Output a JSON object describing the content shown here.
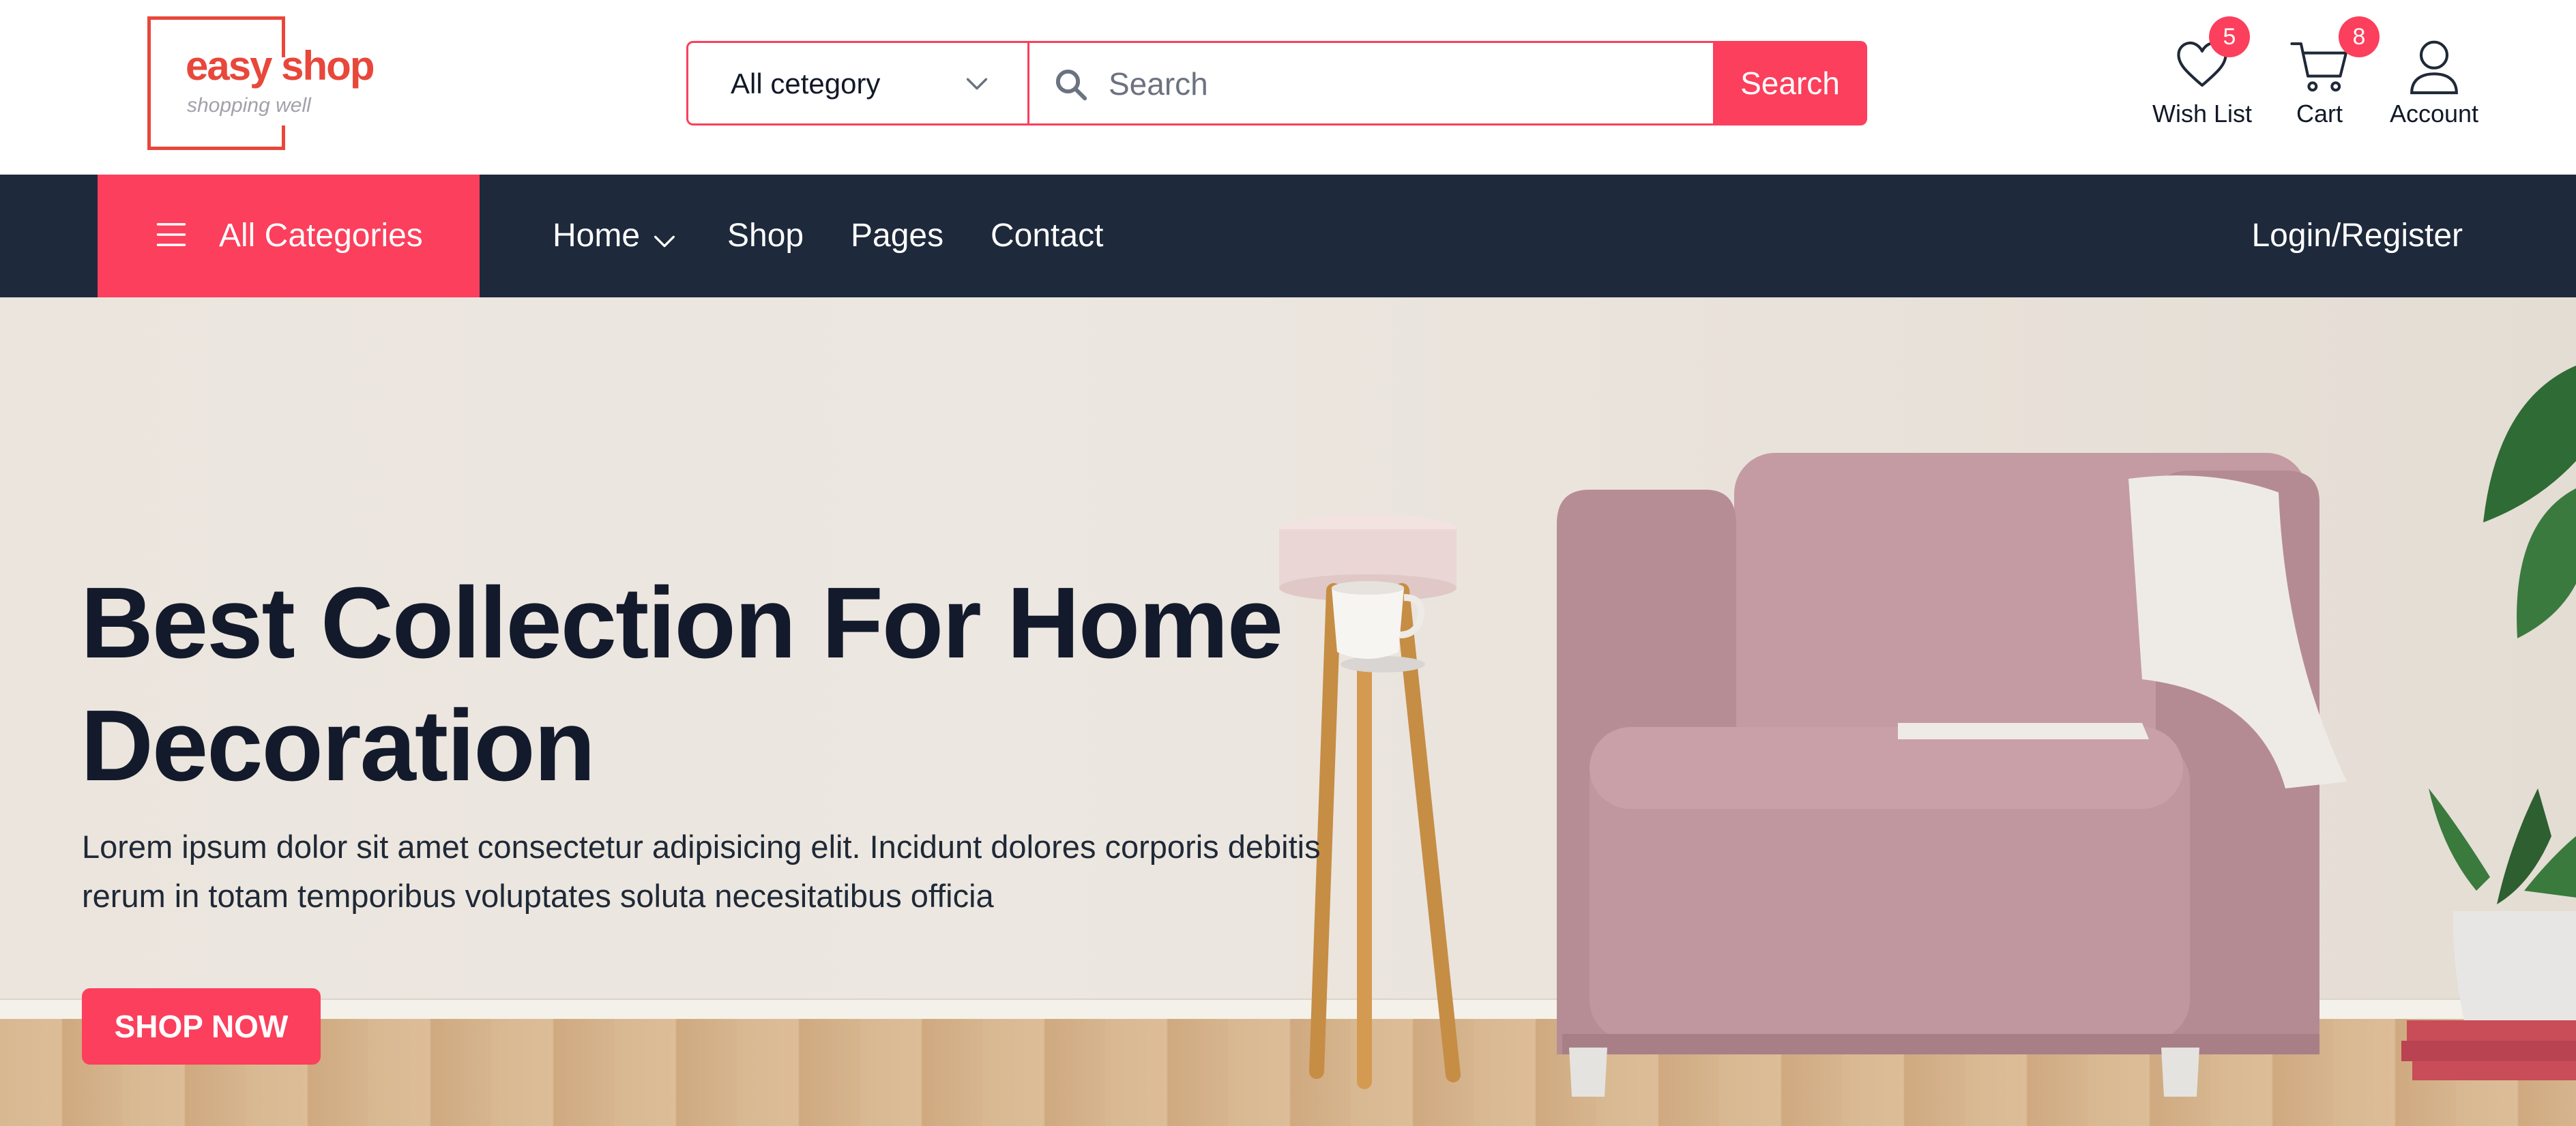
{
  "logo": {
    "title": "easy shop",
    "tagline": "shopping well"
  },
  "search": {
    "category_selected": "All cetegory",
    "placeholder": "Search",
    "button_label": "Search"
  },
  "header_actions": {
    "wishlist": {
      "label": "Wish List",
      "count": "5",
      "icon": "heart-icon"
    },
    "cart": {
      "label": "Cart",
      "count": "8",
      "icon": "cart-icon"
    },
    "account": {
      "label": "Account",
      "icon": "user-icon"
    }
  },
  "nav": {
    "all_categories": "All Categories",
    "links": [
      "Home",
      "Shop",
      "Pages",
      "Contact"
    ],
    "login": "Login/Register"
  },
  "hero": {
    "title": "Best Collection For Home Decoration",
    "description": "Lorem ipsum dolor sit amet consectetur adipisicing elit. Incidunt dolores corporis debitis rerum in totam temporibus voluptates soluta necesitatibus officia",
    "cta": "SHOP NOW"
  },
  "colors": {
    "accent": "#fb3f5c",
    "logo": "#e8473a",
    "nav_bg": "#1e293b",
    "heading": "#131a2b"
  }
}
